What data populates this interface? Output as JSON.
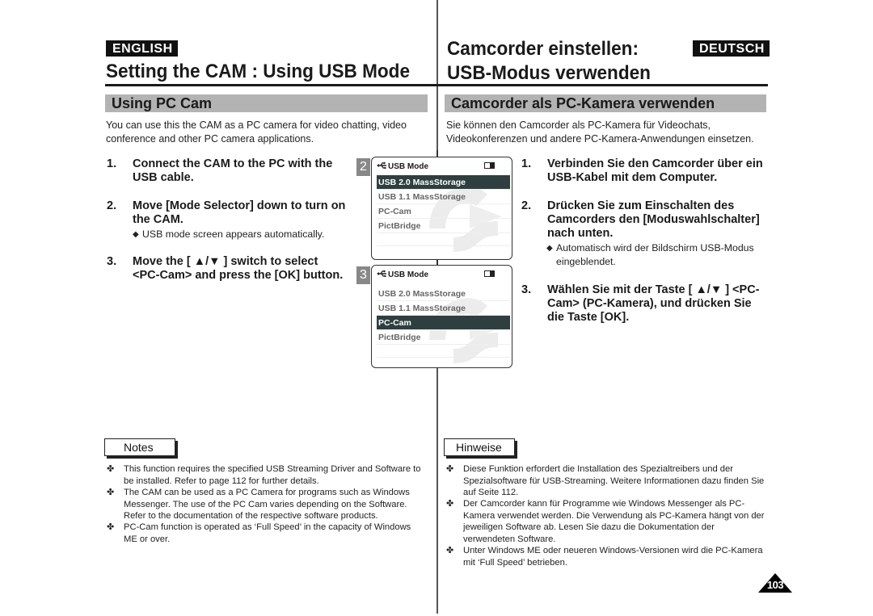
{
  "english": {
    "lang_label": "ENGLISH",
    "title": "Setting the CAM : Using USB Mode",
    "section": "Using PC Cam",
    "intro": "You can use this the CAM as a PC camera for video chatting, video conference and other PC camera applications.",
    "steps": [
      {
        "num": "1.",
        "lines": [
          "Connect the CAM to the PC with the",
          "USB cable."
        ]
      },
      {
        "num": "2.",
        "lines": [
          "Move [Mode Selector] down to turn on",
          "the CAM."
        ],
        "sub": "USB mode screen appears automatically."
      },
      {
        "num": "3.",
        "lines": [
          "Move the [ ▲/▼ ] switch to select",
          "<PC-Cam> and press the [OK] button."
        ]
      }
    ],
    "notes_label": "Notes",
    "notes": [
      {
        "lines": [
          "This function requires the specified USB Streaming Driver and Software to",
          "be installed. Refer to page 112 for further details."
        ]
      },
      {
        "lines": [
          "The CAM can be used as a PC Camera for programs such as Windows",
          "Messenger. The use of the PC Cam varies depending on the Software.",
          "Refer to the documentation of the respective software products."
        ]
      },
      {
        "lines": [
          "PC-Cam function is operated as ‘Full Speed’ in the capacity of Windows",
          "ME or over."
        ]
      }
    ]
  },
  "deutsch": {
    "lang_label": "DEUTSCH",
    "title_line1": "Camcorder einstellen:",
    "title_line2": "USB-Modus verwenden",
    "section": "Camcorder als PC-Kamera verwenden",
    "intro_lines": [
      "Sie können den Camcorder als PC-Kamera für Videochats,",
      "Videokonferenzen und andere PC-Kamera-Anwendungen einsetzen."
    ],
    "steps": [
      {
        "num": "1.",
        "lines": [
          "Verbinden Sie den Camcorder über ein",
          "USB-Kabel mit dem Computer."
        ]
      },
      {
        "num": "2.",
        "lines": [
          "Drücken Sie zum Einschalten des",
          "Camcorders den [Moduswahlschalter]",
          "nach unten."
        ],
        "sub_lines": [
          "Automatisch wird der Bildschirm USB-Modus",
          "eingeblendet."
        ]
      },
      {
        "num": "3.",
        "lines": [
          "Wählen Sie mit der Taste [ ▲/▼ ] <PC-",
          "Cam> (PC-Kamera), und drücken Sie",
          "die Taste [OK]."
        ]
      }
    ],
    "notes_label": "Hinweise",
    "notes": [
      {
        "lines": [
          "Diese Funktion erfordert die Installation des Spezialtreibers und der",
          "Spezialsoftware für USB-Streaming. Weitere Informationen dazu finden Sie",
          "auf Seite 112."
        ]
      },
      {
        "lines": [
          "Der Camcorder kann für Programme wie Windows Messenger als PC-",
          "Kamera verwendet werden. Die Verwendung als PC-Kamera hängt von der",
          "jeweiligen Software ab. Lesen Sie dazu die Dokumentation der",
          "verwendeten Software."
        ]
      },
      {
        "lines": [
          "Unter Windows ME oder neueren Windows-Versionen wird die PC-Kamera",
          "mit ‘Full Speed’ betrieben."
        ]
      }
    ]
  },
  "screens": [
    {
      "step_label": "2",
      "header": "USB Mode",
      "header_icon": "usb-icon",
      "status_icon": "battery-icon",
      "items": [
        "USB 2.0 MassStorage",
        "USB 1.1 MassStorage",
        "PC-Cam",
        "PictBridge"
      ],
      "selected": "USB 2.0 MassStorage"
    },
    {
      "step_label": "3",
      "header": "USB Mode",
      "header_icon": "usb-icon",
      "status_icon": "battery-icon",
      "items": [
        "USB 2.0 MassStorage",
        "USB 1.1 MassStorage",
        "PC-Cam",
        "PictBridge"
      ],
      "selected": "PC-Cam"
    }
  ],
  "bullets": {
    "sub_bullet": "◆",
    "note_bullet": "✤",
    "usb_glyph": "⭠"
  },
  "page_number": "103"
}
